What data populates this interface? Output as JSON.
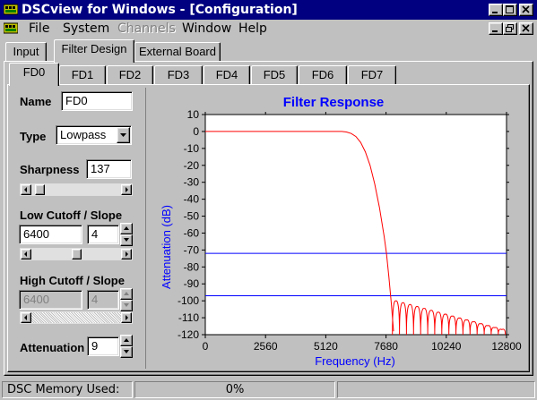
{
  "window": {
    "title": "DSCview for Windows - [Configuration]",
    "controls": [
      "minimize",
      "maximize",
      "close"
    ]
  },
  "menu": {
    "items": [
      {
        "label": "File",
        "enabled": true
      },
      {
        "label": "System",
        "enabled": true
      },
      {
        "label": "Channels",
        "enabled": false
      },
      {
        "label": "Window",
        "enabled": true
      },
      {
        "label": "Help",
        "enabled": true
      }
    ],
    "mdi_controls": [
      "minimize",
      "restore",
      "close"
    ]
  },
  "main_tabs": [
    {
      "label": "Input",
      "active": false
    },
    {
      "label": "Filter Design",
      "active": true
    },
    {
      "label": "External Board",
      "active": false
    }
  ],
  "filter_tabs": [
    {
      "label": "FD0",
      "active": true
    },
    {
      "label": "FD1",
      "active": false
    },
    {
      "label": "FD2",
      "active": false
    },
    {
      "label": "FD3",
      "active": false
    },
    {
      "label": "FD4",
      "active": false
    },
    {
      "label": "FD5",
      "active": false
    },
    {
      "label": "FD6",
      "active": false
    },
    {
      "label": "FD7",
      "active": false
    }
  ],
  "form": {
    "name_label": "Name",
    "name_value": "FD0",
    "type_label": "Type",
    "type_value": "Lowpass",
    "sharpness_label": "Sharpness",
    "sharpness_value": "137",
    "sharpness_slider_fraction": 0.05,
    "low_label": "Low Cutoff / Slope",
    "low_cutoff_value": "6400",
    "low_slope_value": "4",
    "low_slider_fraction": 0.5,
    "high_label": "High Cutoff / Slope",
    "high_cutoff_value": "6400",
    "high_slope_value": "4",
    "high_enabled": false,
    "attenuation_label": "Attenuation",
    "attenuation_value": "9"
  },
  "chart_data": {
    "type": "line",
    "title": "Filter Response",
    "xlabel": "Frequency (Hz)",
    "ylabel": "Attenuation (dB)",
    "xlim": [
      0,
      12800
    ],
    "ylim": [
      -120,
      10
    ],
    "x_ticks": [
      "0",
      "2560",
      "5120",
      "7680",
      "10240",
      "12800"
    ],
    "y_ticks": [
      "10",
      "0",
      "-10",
      "-20",
      "-30",
      "-40",
      "-50",
      "-60",
      "-70",
      "-80",
      "-90",
      "-100",
      "-110",
      "-120"
    ],
    "title_color": "#0000ff",
    "axis_label_color": "#0000ff",
    "series": [
      {
        "color": "#ff0000",
        "x": [
          0,
          5800,
          6000,
          6200,
          6400,
          6600,
          6800,
          7000,
          7200,
          7400,
          7600,
          7700,
          7800,
          7900,
          8000
        ],
        "y": [
          0,
          0,
          -0.3,
          -1.2,
          -3,
          -6.5,
          -12,
          -20,
          -31,
          -45,
          -62,
          -72,
          -86,
          -101,
          -118
        ]
      }
    ],
    "ripple": {
      "color": "#ff0000",
      "start_hz": 7950,
      "end_hz": 12800,
      "lobe_width_hz": 300,
      "peak_db_start": -100,
      "peak_db_end": -117,
      "floor_db": -120
    },
    "reference_lines": [
      {
        "y": -72,
        "color": "#0000ff"
      },
      {
        "y": -97,
        "color": "#0000ff"
      }
    ],
    "grid": false
  },
  "status": {
    "memory_label": "DSC Memory Used:",
    "memory_value": "0%",
    "pane3": ""
  }
}
